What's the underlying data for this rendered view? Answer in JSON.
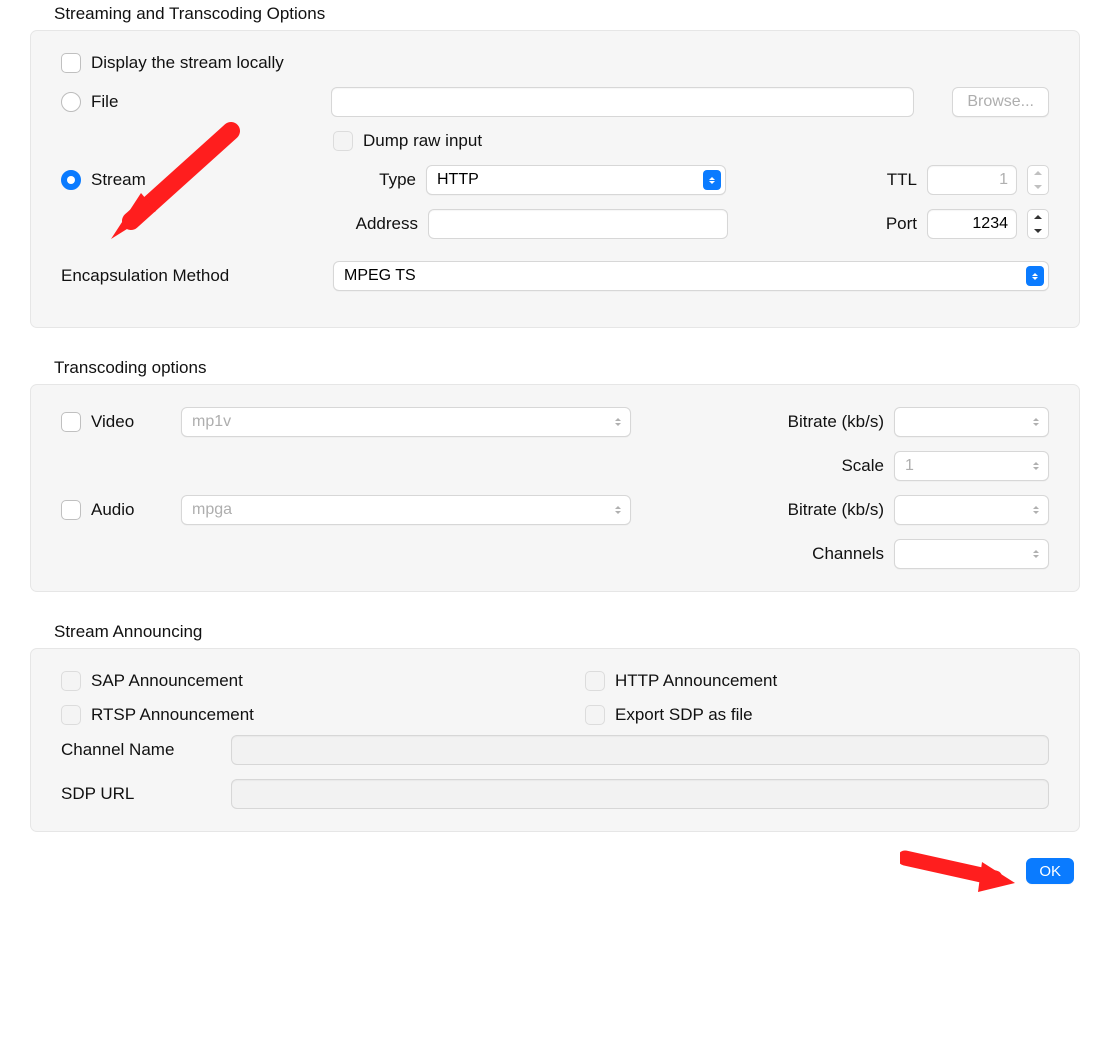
{
  "section1": {
    "title": "Streaming and Transcoding Options",
    "display_locally": "Display the stream locally",
    "file_label": "File",
    "browse": "Browse...",
    "dump_raw": "Dump raw input",
    "stream_label": "Stream",
    "type_label": "Type",
    "type_value": "HTTP",
    "ttl_label": "TTL",
    "ttl_value": "1",
    "address_label": "Address",
    "port_label": "Port",
    "port_value": "1234",
    "encap_label": "Encapsulation Method",
    "encap_value": "MPEG TS"
  },
  "section2": {
    "title": "Transcoding options",
    "video_label": "Video",
    "video_codec": "mp1v",
    "bitrate_label": "Bitrate (kb/s)",
    "scale_label": "Scale",
    "scale_value": "1",
    "audio_label": "Audio",
    "audio_codec": "mpga",
    "channels_label": "Channels"
  },
  "section3": {
    "title": "Stream Announcing",
    "sap": "SAP Announcement",
    "http": "HTTP Announcement",
    "rtsp": "RTSP Announcement",
    "export": "Export SDP as file",
    "channel_name": "Channel Name",
    "sdp_url": "SDP URL"
  },
  "footer": {
    "ok": "OK"
  }
}
